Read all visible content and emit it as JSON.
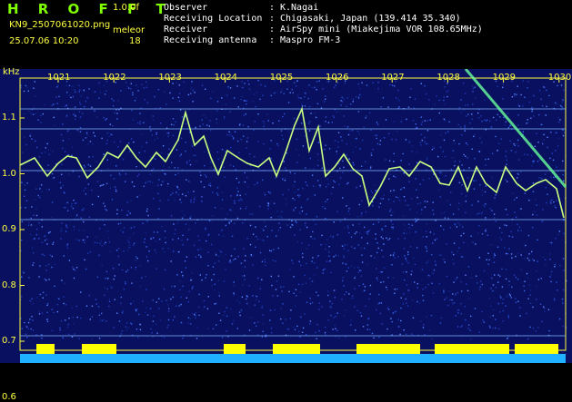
{
  "header": {
    "app_title": "H R O F F T",
    "version": "1.0.0f",
    "filename": "KN9_2507061020.png",
    "datetime": "25.07.06 10:20",
    "mode_label": "meleor",
    "count": "18"
  },
  "info": [
    {
      "key": "Observer",
      "value": "K.Nagai"
    },
    {
      "key": "Receiving Location",
      "value": "Chigasaki, Japan (139.414 35.340)"
    },
    {
      "key": "Receiver",
      "value": "AirSpy mini (Miakejima VOR 108.65MHz)"
    },
    {
      "key": "Receiving antenna",
      "value": "Maspro FM-3"
    }
  ],
  "spectrogram": {
    "unit": "kHz",
    "time_labels": [
      "1021",
      "1022",
      "1023",
      "1024",
      "1025",
      "1026",
      "1027",
      "1028",
      "1029",
      "1030"
    ],
    "freq_labels": [
      "1.1",
      "1.0",
      "0.9",
      "0.8",
      "0.7",
      "0.6"
    ],
    "colors": {
      "background": "#0a1060",
      "label": "#ffff40",
      "trace": "#c8ff80",
      "noise_band": "#ffff00",
      "bottom_band": "#1fb0ff"
    }
  }
}
